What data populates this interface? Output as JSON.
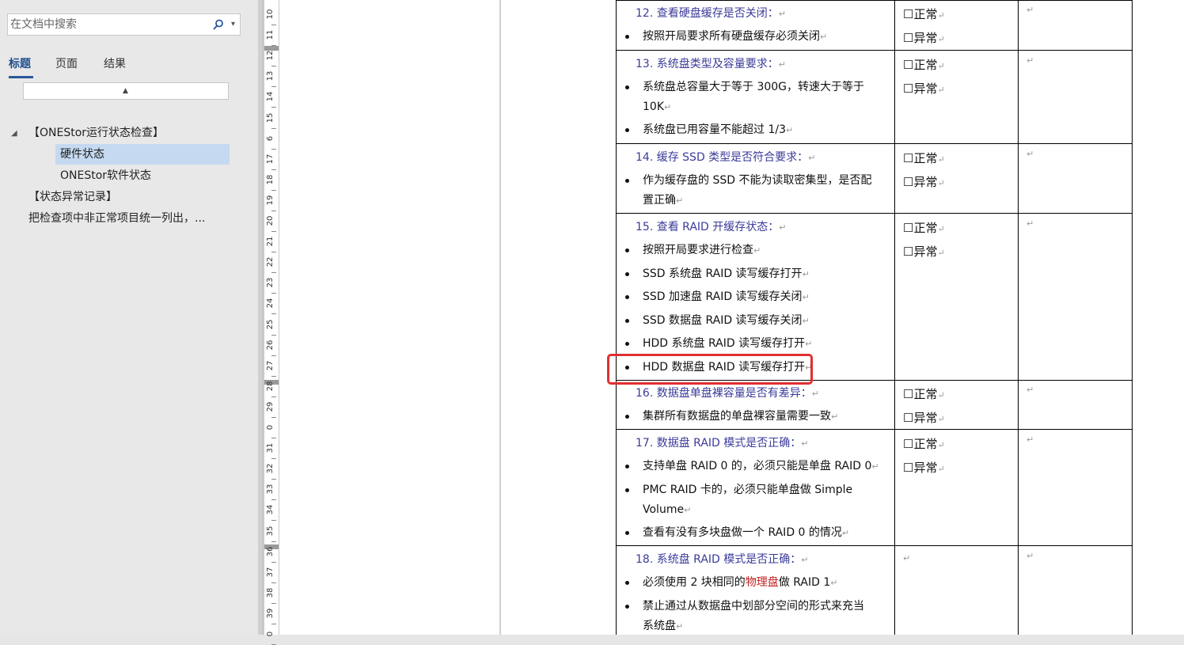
{
  "nav": {
    "search_placeholder": "在文档中搜索",
    "tabs": [
      "标题",
      "页面",
      "结果"
    ],
    "items": [
      "【ONEStor运行状态检查】",
      "硬件状态",
      "ONEStor软件状态",
      "【状态异常记录】",
      "把检查项中非正常项目统一列出，..."
    ]
  },
  "ruler": [
    "10",
    "11",
    "12",
    "13",
    "14",
    "15",
    "6",
    "17",
    "18",
    "19",
    "20",
    "21",
    "22",
    "23",
    "24",
    "25",
    "26",
    "27",
    "28",
    "29",
    "0",
    "31",
    "32",
    "33",
    "34",
    "35",
    "36",
    "37",
    "38",
    "39",
    "0"
  ],
  "options": {
    "normal": "☐正常",
    "abnormal": "☐异常"
  },
  "rows": [
    {
      "head": "12. 查看硬盘缓存是否关闭：",
      "bullets": [
        "按照开局要求所有硬盘缓存必须关闭"
      ]
    },
    {
      "head": "13. 系统盘类型及容量要求：",
      "bullets": [
        "系统盘总容量大于等于 300G，转速大于等于",
        "10K",
        "系统盘已用容量不能超过 1/3"
      ]
    },
    {
      "head": "14. 缓存 SSD 类型是否符合要求：",
      "bullets": [
        "作为缓存盘的 SSD 不能为读取密集型，是否配",
        "置正确"
      ]
    },
    {
      "head": "15. 查看 RAID 开缓存状态：",
      "bullets": [
        "按照开局要求进行检查",
        "SSD 系统盘 RAID 读写缓存打开",
        "SSD 加速盘 RAID 读写缓存关闭",
        "SSD 数据盘 RAID 读写缓存关闭",
        "HDD 系统盘 RAID 读写缓存打开",
        "HDD 数据盘 RAID 读写缓存打开"
      ]
    },
    {
      "head": "16. 数据盘单盘裸容量是否有差异：",
      "bullets": [
        "集群所有数据盘的单盘裸容量需要一致"
      ]
    },
    {
      "head": "17. 数据盘 RAID 模式是否正确：",
      "bullets": [
        "支持单盘 RAID 0 的，必须只能是单盘 RAID 0",
        "PMC  RAID  卡的，必须只能单盘做  Simple",
        "Volume",
        "查看有没有多块盘做一个 RAID 0  的情况"
      ]
    },
    {
      "head": "18. 系统盘 RAID 模式是否正确：",
      "bullets": [
        "必须使用 2 块相同的",
        "物理盘",
        "做 RAID 1",
        "禁止通过从数据盘中划部分空间的形式来充当",
        "系统盘"
      ]
    }
  ]
}
